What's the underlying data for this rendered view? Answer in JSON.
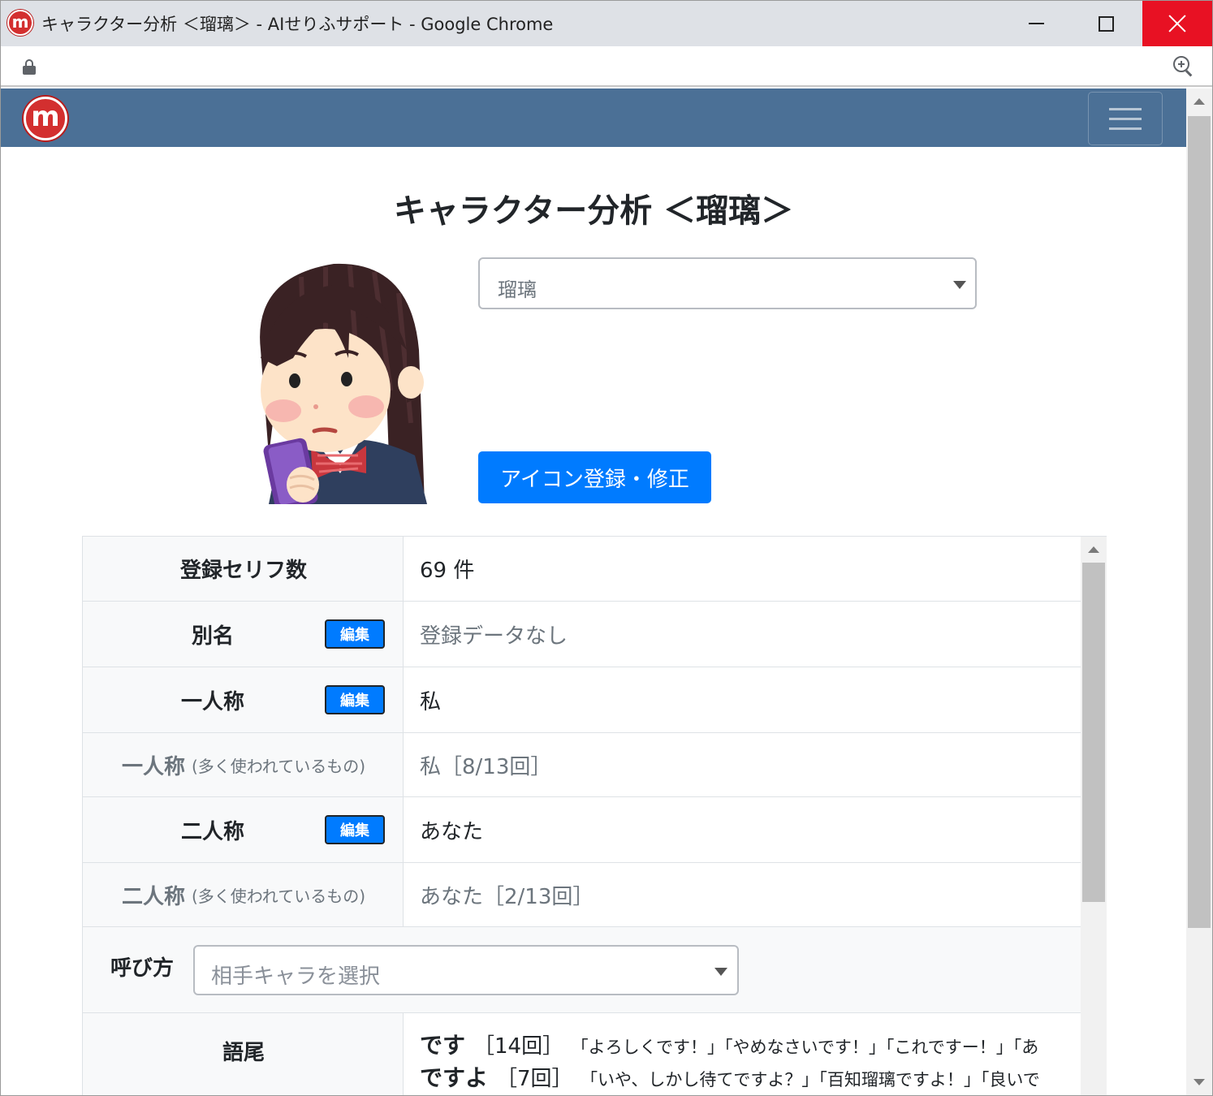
{
  "window": {
    "title": "キャラクター分析 ＜瑠璃＞ - AIせりふサポート - Google Chrome"
  },
  "page": {
    "title": "キャラクター分析 ＜瑠璃＞"
  },
  "character_select": {
    "value": "瑠璃"
  },
  "icon_button": {
    "label": "アイコン登録・修正"
  },
  "table": {
    "registered_lines": {
      "label": "登録セリフ数",
      "value": "69 件"
    },
    "alias": {
      "label": "別名",
      "edit": "編集",
      "value": "登録データなし"
    },
    "first_person": {
      "label": "一人称",
      "edit": "編集",
      "value": "私"
    },
    "first_person_common": {
      "label": "一人称",
      "note": "(多く使われているもの)",
      "value": "私［8/13回］"
    },
    "second_person": {
      "label": "二人称",
      "edit": "編集",
      "value": "あなた"
    },
    "second_person_common": {
      "label": "二人称",
      "note": "(多く使われているもの)",
      "value": "あなた［2/13回］"
    },
    "call_name": {
      "label": "呼び方",
      "placeholder": "相手キャラを選択"
    },
    "endings": {
      "label": "語尾",
      "items": [
        {
          "word": "です",
          "count": "［14回］",
          "examples": "「よろしくです！」「やめなさいです！」「これですー！」「あ"
        },
        {
          "word": "ですよ",
          "count": "［7回］",
          "examples": "「いや、しかし待てですよ？」「百知瑠璃ですよ！」「良いで"
        }
      ]
    }
  },
  "colors": {
    "navbar": "#4b7096",
    "primary": "#007bff",
    "close": "#e81123"
  },
  "icons": [
    "app-icon",
    "lock-icon",
    "zoom-icon",
    "brand-logo",
    "hamburger-icon",
    "chevron-down-icon"
  ]
}
